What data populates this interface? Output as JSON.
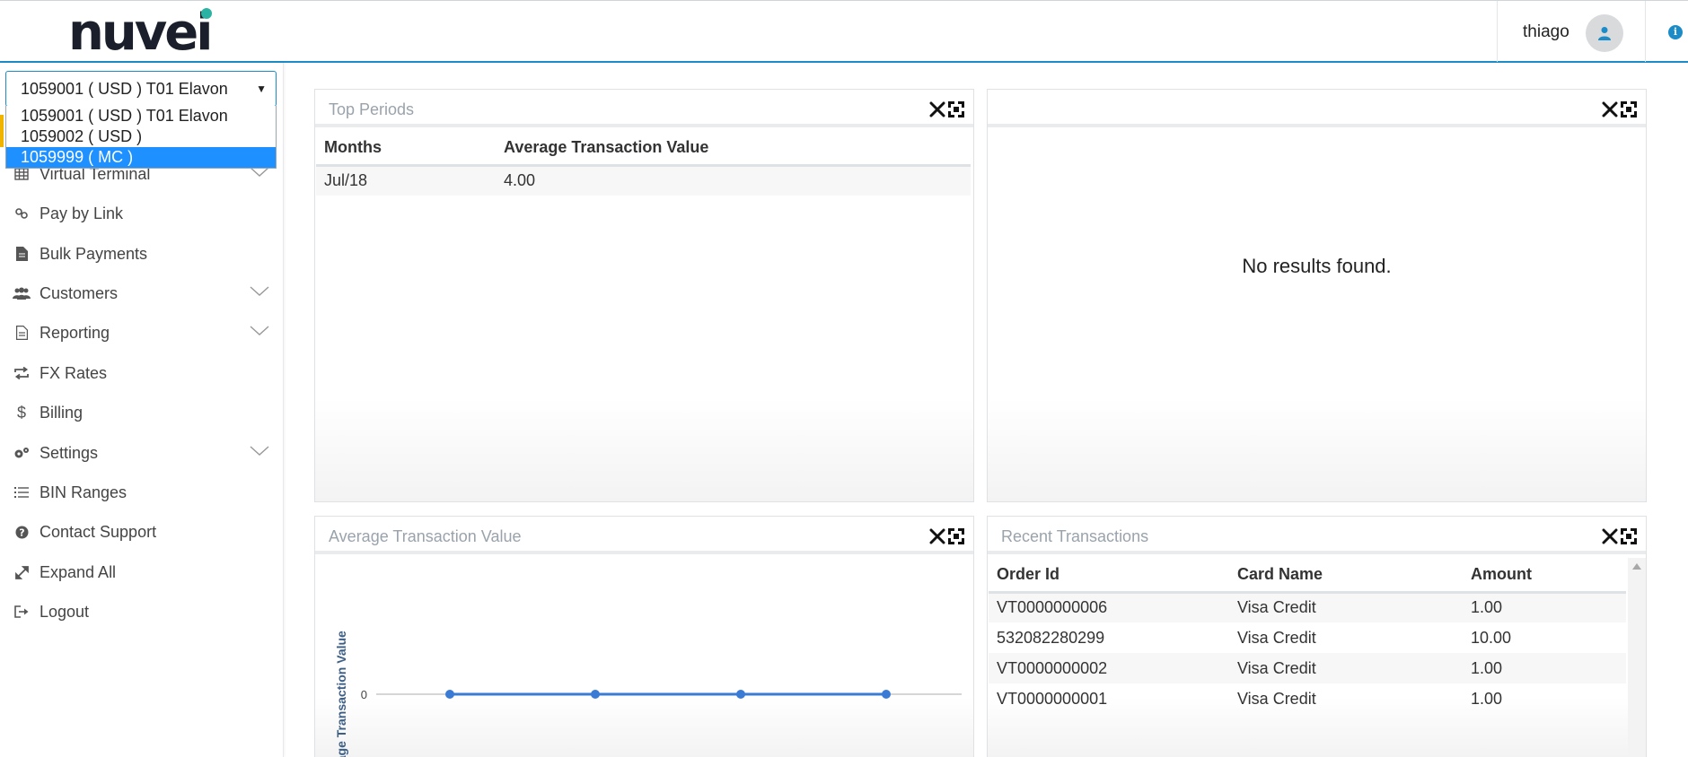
{
  "header": {
    "logo_text": "nuvei",
    "username": "thiago"
  },
  "account": {
    "selected": "1059001 ( USD ) T01 Elavon",
    "options": [
      "1059001 ( USD ) T01 Elavon",
      "1059002 ( USD )",
      "1059999 ( MC )"
    ],
    "highlighted_index": 2
  },
  "sidebar": {
    "items": [
      {
        "label": "Virtual Terminal",
        "icon": "grid-icon",
        "expandable": true
      },
      {
        "label": "Pay by Link",
        "icon": "link-icon",
        "expandable": false
      },
      {
        "label": "Bulk Payments",
        "icon": "file-icon",
        "expandable": false
      },
      {
        "label": "Customers",
        "icon": "users-icon",
        "expandable": true
      },
      {
        "label": "Reporting",
        "icon": "document-icon",
        "expandable": true
      },
      {
        "label": "FX Rates",
        "icon": "exchange-icon",
        "expandable": false
      },
      {
        "label": "Billing",
        "icon": "dollar-icon",
        "expandable": false
      },
      {
        "label": "Settings",
        "icon": "gears-icon",
        "expandable": true
      },
      {
        "label": "BIN Ranges",
        "icon": "list-icon",
        "expandable": false
      },
      {
        "label": "Contact Support",
        "icon": "question-icon",
        "expandable": false
      },
      {
        "label": "Expand All",
        "icon": "expand-icon",
        "expandable": false
      },
      {
        "label": "Logout",
        "icon": "logout-icon",
        "expandable": false
      }
    ]
  },
  "panels": {
    "top_periods": {
      "title": "Top Periods",
      "columns": [
        "Months",
        "Average Transaction Value"
      ],
      "rows": [
        [
          "Jul/18",
          "4.00"
        ]
      ]
    },
    "empty_panel": {
      "title": "",
      "message": "No results found."
    },
    "avg_transaction": {
      "title": "Average Transaction Value"
    },
    "recent_transactions": {
      "title": "Recent Transactions",
      "columns": [
        "Order Id",
        "Card Name",
        "Amount"
      ],
      "rows": [
        [
          "VT0000000006",
          "Visa Credit",
          "1.00"
        ],
        [
          "532082280299",
          "Visa Credit",
          "10.00"
        ],
        [
          "VT0000000002",
          "Visa Credit",
          "1.00"
        ],
        [
          "VT0000000001",
          "Visa Credit",
          "1.00"
        ]
      ]
    }
  },
  "chart_data": {
    "type": "line",
    "title": "",
    "ylabel": "Average Transaction Value",
    "xlabel": "",
    "y_ticks": [
      "0"
    ],
    "series": [
      {
        "values": [
          0,
          0,
          0,
          0
        ]
      }
    ],
    "accent_color": "#3a7bd5"
  },
  "colors": {
    "brand_blue": "#1b8cc8",
    "accent_teal": "#2ab3a3",
    "active_marker": "#f0b400",
    "dropdown_highlight": "#1e90ff"
  }
}
